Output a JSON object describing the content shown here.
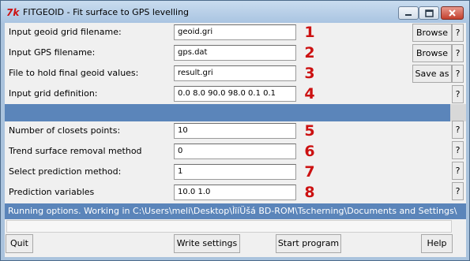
{
  "window": {
    "icon_text": "7k",
    "title": "FITGEOID - Fit surface to GPS levelling"
  },
  "fields": [
    {
      "label": "Input geoid grid filename:",
      "value": "geoid.gri",
      "marker": "1",
      "button": "Browse",
      "help": "?"
    },
    {
      "label": "Input GPS filename:",
      "value": "gps.dat",
      "marker": "2",
      "button": "Browse",
      "help": "?"
    },
    {
      "label": "File to hold final geoid values:",
      "value": "result.gri",
      "marker": "3",
      "button": "Save as",
      "help": "?"
    },
    {
      "label": "Input grid definition:",
      "value": "0.0 8.0 90.0 98.0 0.1 0.1",
      "marker": "4",
      "help": "?"
    },
    {
      "label": "Number of closets points:",
      "value": "10",
      "marker": "5",
      "help": "?"
    },
    {
      "label": "Trend surface removal method",
      "value": "0",
      "marker": "6",
      "help": "?"
    },
    {
      "label": "Select prediction method:",
      "value": "1",
      "marker": "7",
      "help": "?"
    },
    {
      "label": "Prediction variables",
      "value": "10.0 1.0",
      "marker": "8",
      "help": "?"
    }
  ],
  "status": {
    "text": "Running options. Working in C:\\Users\\meli\\Desktop\\ÌïíÜšá BD-ROM\\Tscherning\\Documents and Settings\\"
  },
  "buttons": {
    "quit": "Quit",
    "write_settings": "Write settings",
    "start_program": "Start program",
    "help": "Help"
  },
  "colors": {
    "accent": "#5b85ba",
    "marker": "#cc1111",
    "title_bar": "#aac3dd"
  }
}
